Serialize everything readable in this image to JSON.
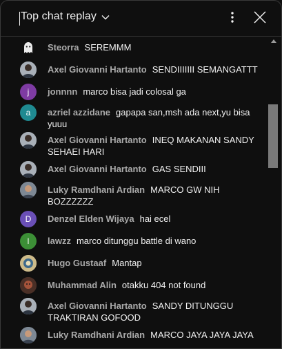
{
  "header": {
    "title": "Top chat replay",
    "chevron_icon": "chevron-down-icon",
    "more_icon": "more-vert-icon",
    "close_icon": "close-icon"
  },
  "colors": {
    "background": "#0f0f0f",
    "text": "#f1f1f1",
    "author": "#aaaaaa",
    "avatar_j": "#7e3ba3",
    "avatar_a": "#1f8a91",
    "avatar_d": "#6a4fb6",
    "avatar_l": "#3c8f36",
    "scrollbar_thumb": "#7a7a7a"
  },
  "messages": [
    {
      "author": "Steorra",
      "text": "SEREMMM",
      "avatar": "ghost-icon"
    },
    {
      "author": "Axel Giovanni Hartanto",
      "text": "SENDIIIIIII SEMANGATTT",
      "avatar": "photo"
    },
    {
      "author": "jonnnn",
      "text": "marco bisa jadi colosal ga",
      "avatar": "j"
    },
    {
      "author": "azriel azzidane",
      "text": "gapapa san,msh ada next,yu bisa yuuu",
      "avatar": "a"
    },
    {
      "author": "Axel Giovanni Hartanto",
      "text": "INEQ MAKANAN SANDY SEHAEI HARI",
      "avatar": "photo"
    },
    {
      "author": "Axel Giovanni Hartanto",
      "text": "GAS SENDIII",
      "avatar": "photo"
    },
    {
      "author": "Luky Ramdhani Ardian",
      "text": "MARCO GW NIH BOZZZZZZ",
      "avatar": "photo"
    },
    {
      "author": "Denzel Elden Wijaya",
      "text": "hai ecel",
      "avatar": "D"
    },
    {
      "author": "lawzz",
      "text": "marco ditunggu battle di wano",
      "avatar": "l"
    },
    {
      "author": "Hugo Gustaaf",
      "text": "Mantap",
      "avatar": "photo"
    },
    {
      "author": "Muhammad Alin",
      "text": "otakku 404 not found",
      "avatar": "photo"
    },
    {
      "author": "Axel Giovanni Hartanto",
      "text": "SANDY DITUNGGU TRAKTIRAN GOFOOD",
      "avatar": "photo"
    },
    {
      "author": "Luky Ramdhani Ardian",
      "text": "MARCO JAYA JAYA JAYA",
      "avatar": "photo"
    }
  ]
}
